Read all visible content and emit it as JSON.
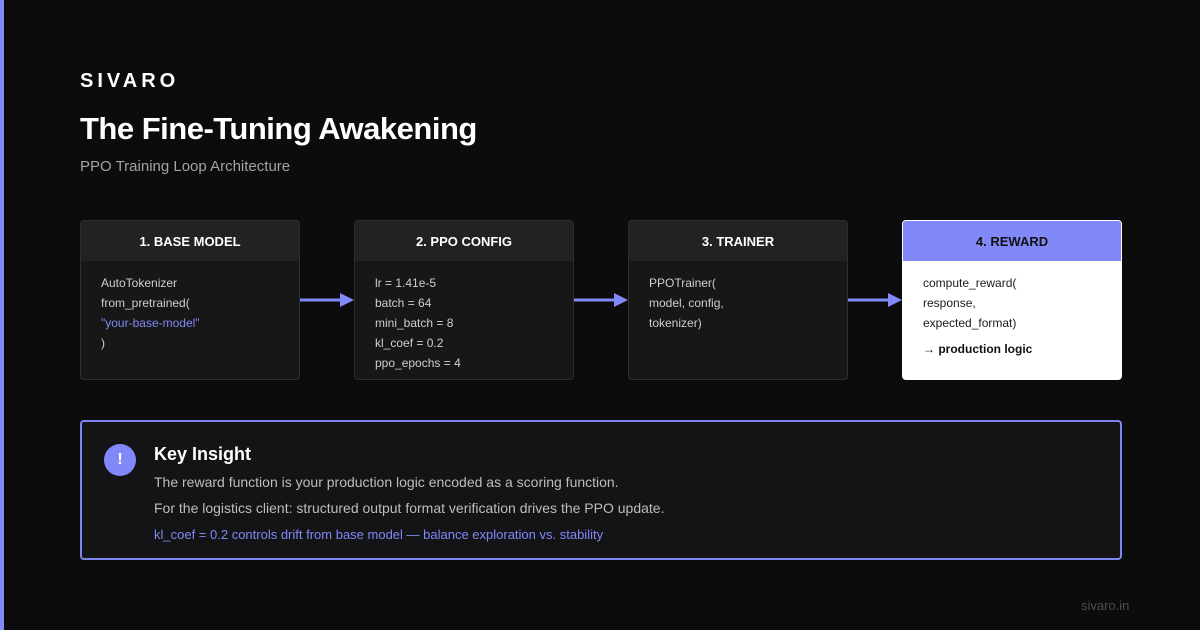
{
  "brand": "SIVARO",
  "title": "The Fine-Tuning Awakening",
  "subtitle": "PPO Training Loop Architecture",
  "colors": {
    "accent": "#8188f7",
    "background": "#0c0c0c",
    "card": "#171717",
    "card_active": "#ffffff"
  },
  "steps": [
    {
      "header": "1. BASE MODEL",
      "lines": [
        "AutoTokenizer",
        "from_pretrained(",
        "\"your-base-model\"",
        ")"
      ]
    },
    {
      "header": "2. PPO CONFIG",
      "lines": [
        "lr = 1.41e-5",
        "batch = 64",
        "mini_batch = 8",
        "kl_coef = 0.2",
        "ppo_epochs = 4"
      ]
    },
    {
      "header": "3. TRAINER",
      "lines": [
        "PPOTrainer(",
        "model, config,",
        "tokenizer)"
      ]
    },
    {
      "header": "4. REWARD",
      "lines": [
        "compute_reward(",
        "response,",
        "expected_format)"
      ],
      "emphasis": "→ production logic"
    }
  ],
  "insight": {
    "icon": "exclamation-icon",
    "icon_glyph": "!",
    "title": "Key Insight",
    "line1": "The reward function is your production logic encoded as a scoring function.",
    "line2": "For the logistics client: structured output format verification drives the PPO update.",
    "line3": "kl_coef = 0.2 controls drift from base model — balance exploration vs. stability"
  },
  "footer": "sivaro.in"
}
